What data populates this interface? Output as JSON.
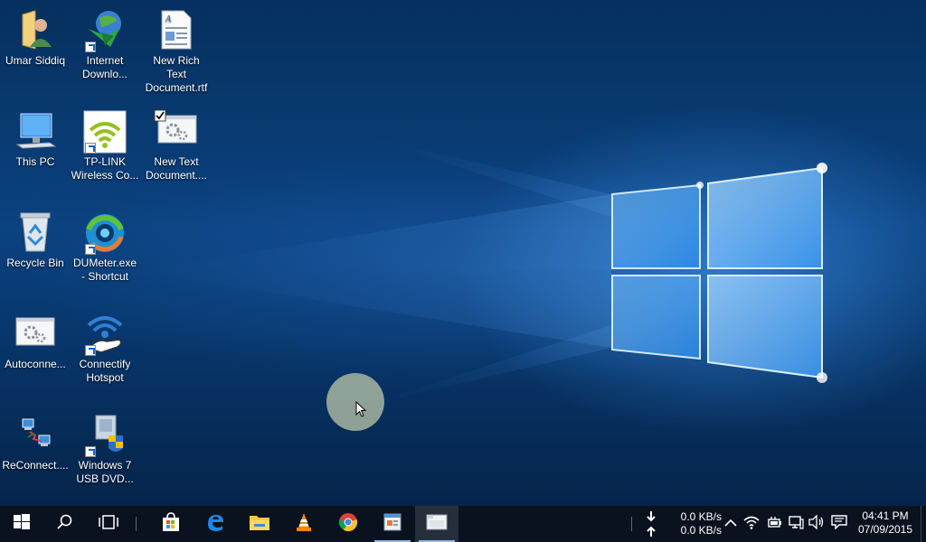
{
  "desktop": {
    "icons": [
      {
        "label": "Umar Siddiq",
        "icon": "user-folder-icon"
      },
      {
        "label": "Internet Downlo...",
        "icon": "internet-download-manager-icon"
      },
      {
        "label": "New Rich Text Document.rtf",
        "icon": "rich-text-document-icon"
      },
      {
        "label": "This PC",
        "icon": "computer-icon"
      },
      {
        "label": "TP-LINK Wireless Co...",
        "icon": "tp-link-wifi-icon"
      },
      {
        "label": "New Text Document....",
        "icon": "settings-file-icon"
      },
      {
        "label": "Recycle Bin",
        "icon": "recycle-bin-icon"
      },
      {
        "label": "DUMeter.exe - Shortcut",
        "icon": "dumeter-icon"
      },
      {
        "label": "Autoconne...",
        "icon": "settings-file-icon"
      },
      {
        "label": "Connectify Hotspot",
        "icon": "connectify-hotspot-icon"
      },
      {
        "label": "ReConnect....",
        "icon": "network-computers-icon"
      },
      {
        "label": "Windows 7 USB DVD...",
        "icon": "windows-usb-dvd-tool-icon"
      }
    ]
  },
  "taskbar": {
    "buttons": [
      {
        "name": "start",
        "icon": "windows-start-icon"
      },
      {
        "name": "search",
        "icon": "search-icon"
      },
      {
        "name": "task-view",
        "icon": "task-view-icon"
      },
      {
        "name": "store",
        "icon": "store-icon"
      },
      {
        "name": "edge",
        "icon": "edge-icon"
      },
      {
        "name": "file-explorer",
        "icon": "folder-icon"
      },
      {
        "name": "vlc",
        "icon": "vlc-icon"
      },
      {
        "name": "chrome",
        "icon": "chrome-icon"
      },
      {
        "name": "app-window",
        "icon": "app-window-icon"
      },
      {
        "name": "screen-recorder",
        "icon": "screen-recorder-icon"
      }
    ],
    "tray": {
      "download_speed": "0.0 KB/s",
      "upload_speed": "0.0 KB/s",
      "time": "04:41 PM",
      "date": "07/09/2015"
    }
  },
  "colors": {
    "taskbar_bg": "#0a1220",
    "accent": "#8fb5e6",
    "wallpaper_blue": "#0b4280"
  }
}
